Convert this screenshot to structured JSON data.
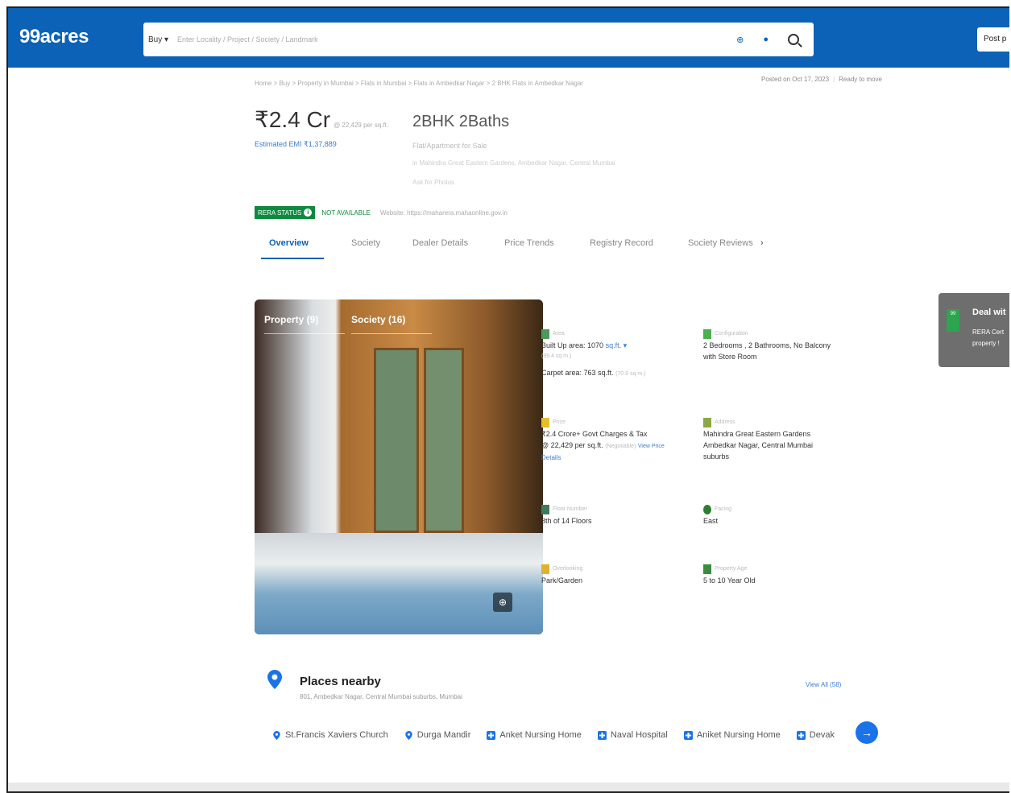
{
  "header": {
    "logo": "99acres",
    "buy_label": "Buy ▾",
    "search_placeholder": "Enter Locality / Project / Society / Landmark",
    "post_label": "Post p"
  },
  "meta": {
    "breadcrumb": "Home > Buy > Property in Mumbai > Flats in Mumbai > Flats in Ambedkar Nagar > 2 BHK Flats in Ambedkar Nagar",
    "posted": "Posted on Oct 17, 2023",
    "status": "Ready to move"
  },
  "listing": {
    "price": "₹2.4 Cr",
    "price_unit": "@ 22,429 per sq.ft.",
    "emi": "Estimated EMI ₹1,37,889",
    "title": "2BHK 2Baths",
    "subtitle": "Flat/Apartment for Sale",
    "location": "in Mahindra Great Eastern Gardens, Ambedkar Nagar, Central Mumbai",
    "extra": "Ask for Photos"
  },
  "rera": {
    "badge": "RERA STATUS",
    "status": "NOT AVAILABLE",
    "website": "Website: https://maharera.mahaonline.gov.in"
  },
  "tabs": [
    "Overview",
    "Society",
    "Dealer Details",
    "Price Trends",
    "Registry Record",
    "Society Reviews"
  ],
  "gallery": {
    "tab_property": "Property (9)",
    "tab_society": "Society (16)"
  },
  "details": {
    "area_label": "Area",
    "built_up": "Built Up area: 1070",
    "built_up_unit": "sq.ft. ▾",
    "carpet_label": "(99.4 sq.m.)",
    "carpet": "Carpet area: 763 sq.ft.",
    "carpet_note": "(70.9 sq.m.)",
    "config_label": "Configuration",
    "config": "2 Bedrooms , 2 Bathrooms, No Balcony",
    "config2": "with Store Room",
    "price_label": "Price",
    "price_line": "₹2.4 Crore+ Govt Charges & Tax",
    "price_sqft": "@ 22,429 per sq.ft.",
    "negotiable": "(Negotiable)",
    "view_price": "View Price",
    "details_link": "Details",
    "address_label": "Address",
    "address1": "Mahindra Great Eastern Gardens",
    "address2": "Ambedkar Nagar, Central Mumbai",
    "address3": "suburbs",
    "floor_label": "Floor Number",
    "floor": "8th of 14 Floors",
    "facing_label": "Facing",
    "facing": "East",
    "overlooking_label": "Overlooking",
    "overlooking": "Park/Garden",
    "age_label": "Property Age",
    "age": "5 to 10 Year Old"
  },
  "deal": {
    "title": "Deal wit",
    "line1": "RERA Cert",
    "line2": "property !"
  },
  "places": {
    "title": "Places nearby",
    "address": "801, Ambedkar Nagar, Central Mumbai suburbs, Mumbai",
    "view_all": "View All (58)",
    "items": [
      {
        "label": "St.Francis Xaviers Church",
        "kind": "pin"
      },
      {
        "label": "Durga Mandir",
        "kind": "pin"
      },
      {
        "label": "Anket Nursing Home",
        "kind": "hospital"
      },
      {
        "label": "Naval Hospital",
        "kind": "hospital"
      },
      {
        "label": "Aniket Nursing Home",
        "kind": "hospital"
      },
      {
        "label": "Devak",
        "kind": "hospital"
      }
    ]
  },
  "colors": {
    "brand_blue": "#0b62b7",
    "rera_green": "#0d8a3e",
    "link_blue": "#3a7bd5"
  }
}
